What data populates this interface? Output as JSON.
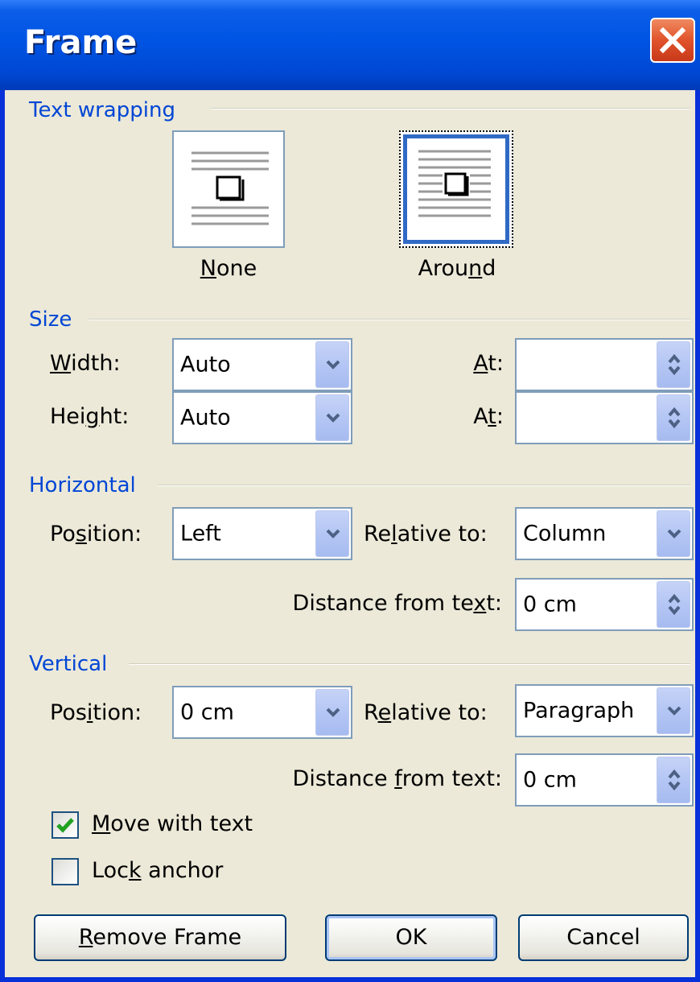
{
  "window": {
    "title": "Frame"
  },
  "text_wrapping": {
    "label": "Text wrapping",
    "options": [
      {
        "label_pre": "",
        "label_u": "N",
        "label_post": "one",
        "icon": "wrap-none-icon",
        "selected": false
      },
      {
        "label_pre": "Arou",
        "label_u": "n",
        "label_post": "d",
        "icon": "wrap-around-icon",
        "selected": true
      }
    ]
  },
  "size": {
    "label": "Size",
    "width": {
      "label_pre": "",
      "label_u": "W",
      "label_post": "idth:",
      "value": "Auto"
    },
    "width_at": {
      "label_pre": "",
      "label_u": "A",
      "label_post": "t:",
      "value": ""
    },
    "height": {
      "label_pre": "Hei",
      "label_u": "g",
      "label_post": "ht:",
      "value": "Auto"
    },
    "height_at": {
      "label_pre": "A",
      "label_u": "t",
      "label_post": ":",
      "value": ""
    }
  },
  "horizontal": {
    "label": "Horizontal",
    "position": {
      "label_pre": "Po",
      "label_u": "s",
      "label_post": "ition:",
      "value": "Left"
    },
    "relative_to": {
      "label_pre": "Re",
      "label_u": "l",
      "label_post": "ative to:",
      "value": "Column"
    },
    "distance": {
      "label_pre": "Distance from te",
      "label_u": "x",
      "label_post": "t:",
      "value": "0 cm"
    }
  },
  "vertical": {
    "label": "Vertical",
    "position": {
      "label_pre": "Pos",
      "label_u": "i",
      "label_post": "tion:",
      "value": "0 cm"
    },
    "relative_to": {
      "label_pre": "R",
      "label_u": "e",
      "label_post": "lative to:",
      "value": "Paragraph"
    },
    "distance": {
      "label_pre": "Distance ",
      "label_u": "f",
      "label_post": "rom text:",
      "value": "0 cm"
    }
  },
  "options": {
    "move_with_text": {
      "label_pre": "",
      "label_u": "M",
      "label_post": "ove with text",
      "checked": true
    },
    "lock_anchor": {
      "label_pre": "Loc",
      "label_u": "k",
      "label_post": " anchor",
      "checked": false
    }
  },
  "buttons": {
    "remove_frame": {
      "label_pre": "",
      "label_u": "R",
      "label_post": "emove Frame"
    },
    "ok": {
      "label_pre": "OK",
      "label_u": "",
      "label_post": ""
    },
    "cancel": {
      "label_pre": "Cancel",
      "label_u": "",
      "label_post": ""
    }
  },
  "colors": {
    "title_bar": "#0054e3",
    "group_label": "#0046d5",
    "dialog_bg": "#ece9d8",
    "close_button": "#e0532b",
    "check_mark": "#21a121"
  }
}
